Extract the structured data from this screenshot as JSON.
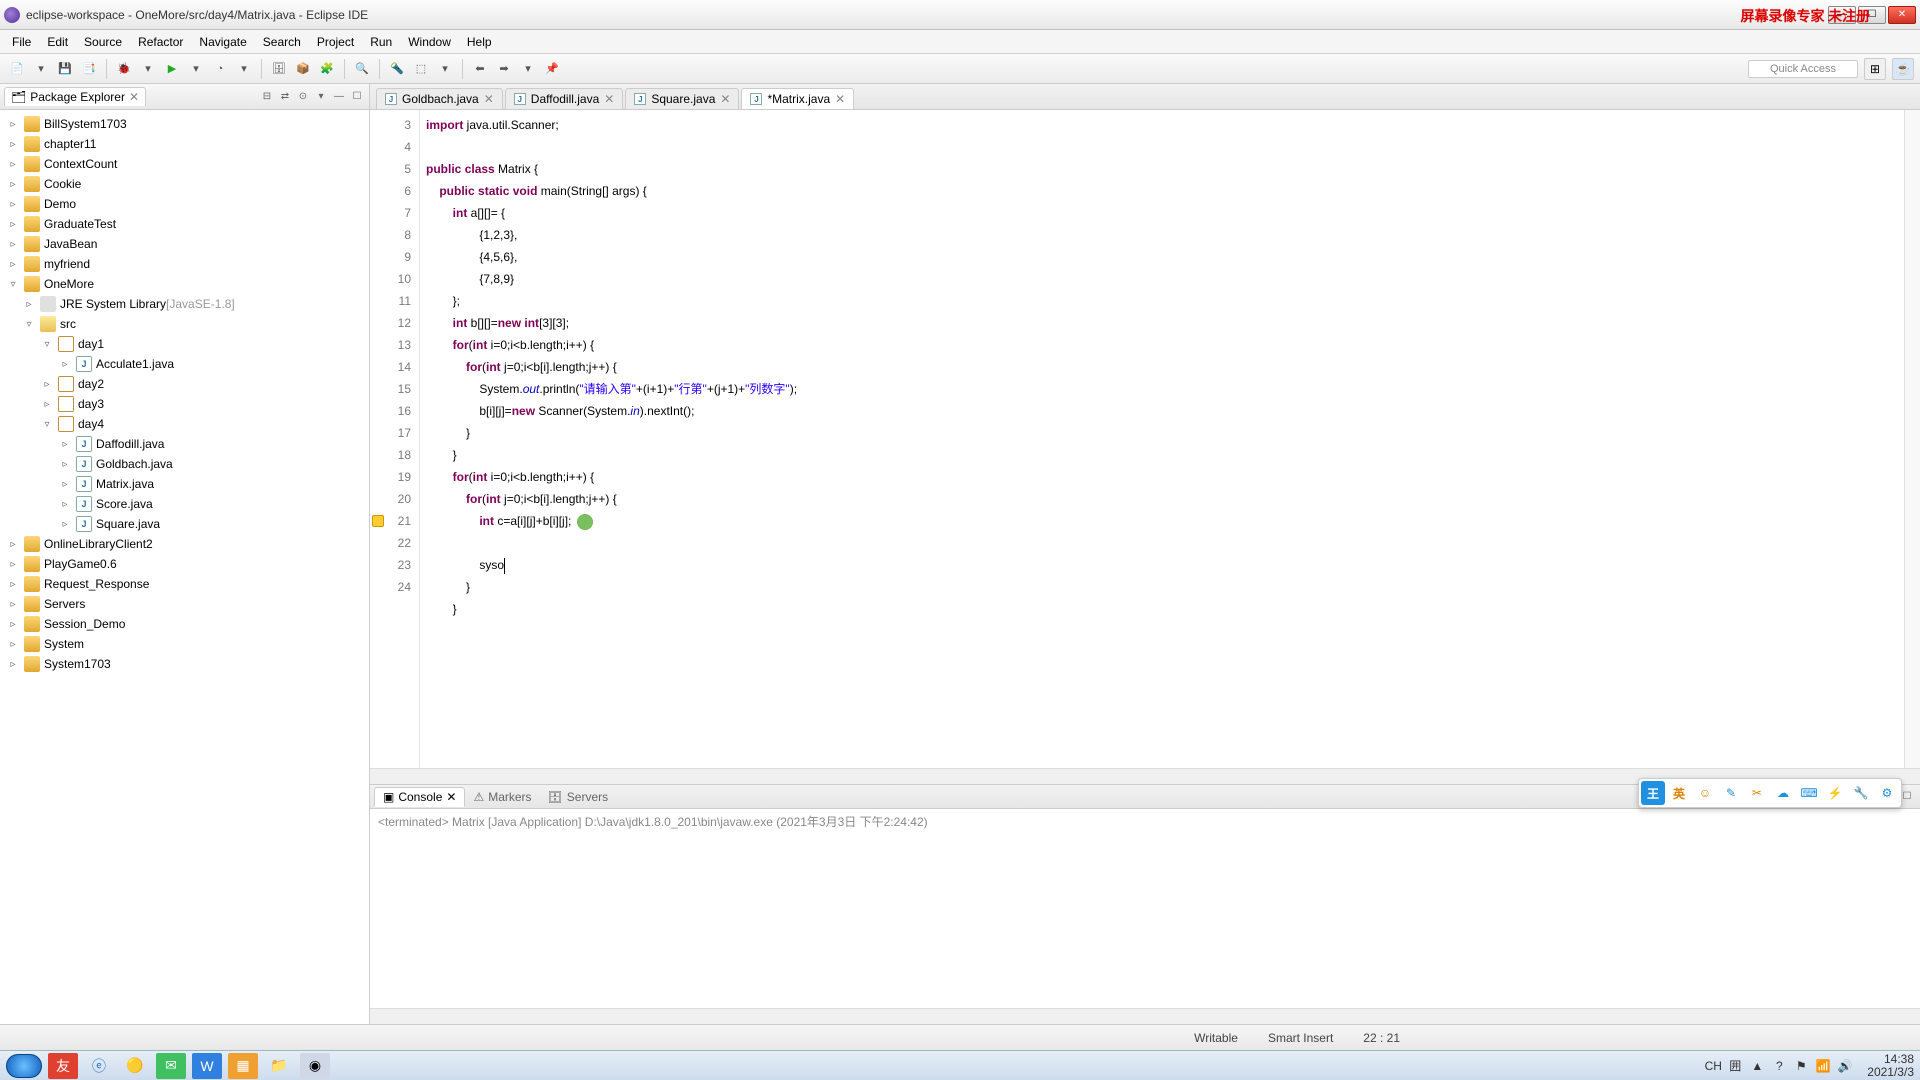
{
  "window": {
    "title": "eclipse-workspace - OneMore/src/day4/Matrix.java - Eclipse IDE",
    "overlay_text": "屏幕录像专家 未注册"
  },
  "menus": [
    "File",
    "Edit",
    "Source",
    "Refactor",
    "Navigate",
    "Search",
    "Project",
    "Run",
    "Window",
    "Help"
  ],
  "quick_access": "Quick Access",
  "package_explorer": {
    "title": "Package Explorer",
    "projects": [
      {
        "name": "BillSystem1703",
        "type": "prj",
        "exp": "▹"
      },
      {
        "name": "chapter11",
        "type": "prj",
        "exp": "▹"
      },
      {
        "name": "ContextCount",
        "type": "prj",
        "exp": "▹"
      },
      {
        "name": "Cookie",
        "type": "prj",
        "exp": "▹"
      },
      {
        "name": "Demo",
        "type": "prj",
        "exp": "▹"
      },
      {
        "name": "GraduateTest",
        "type": "prj",
        "exp": "▹"
      },
      {
        "name": "JavaBean",
        "type": "prj",
        "exp": "▹"
      },
      {
        "name": "myfriend",
        "type": "prj",
        "exp": "▹"
      },
      {
        "name": "OneMore",
        "type": "prj",
        "exp": "▿",
        "children": [
          {
            "name": "JRE System Library",
            "suffix": "[JavaSE-1.8]",
            "type": "lib",
            "exp": "▹",
            "pad": "pad1"
          },
          {
            "name": "src",
            "type": "fld",
            "exp": "▿",
            "pad": "pad1",
            "children": [
              {
                "name": "day1",
                "type": "pkg",
                "exp": "▿",
                "pad": "pad2",
                "children": [
                  {
                    "name": "Acculate1.java",
                    "type": "jfile",
                    "exp": "▹",
                    "pad": "pad3"
                  }
                ]
              },
              {
                "name": "day2",
                "type": "pkg",
                "exp": "▹",
                "pad": "pad2"
              },
              {
                "name": "day3",
                "type": "pkg",
                "exp": "▹",
                "pad": "pad2"
              },
              {
                "name": "day4",
                "type": "pkg",
                "exp": "▿",
                "pad": "pad2",
                "children": [
                  {
                    "name": "Daffodill.java",
                    "type": "jfile",
                    "exp": "▹",
                    "pad": "pad3"
                  },
                  {
                    "name": "Goldbach.java",
                    "type": "jfile",
                    "exp": "▹",
                    "pad": "pad3"
                  },
                  {
                    "name": "Matrix.java",
                    "type": "jfile",
                    "exp": "▹",
                    "pad": "pad3"
                  },
                  {
                    "name": "Score.java",
                    "type": "jfile",
                    "exp": "▹",
                    "pad": "pad3"
                  },
                  {
                    "name": "Square.java",
                    "type": "jfile",
                    "exp": "▹",
                    "pad": "pad3"
                  }
                ]
              }
            ]
          }
        ]
      },
      {
        "name": "OnlineLibraryClient2",
        "type": "prj",
        "exp": "▹"
      },
      {
        "name": "PlayGame0.6",
        "type": "prj",
        "exp": "▹"
      },
      {
        "name": "Request_Response",
        "type": "prj",
        "exp": "▹"
      },
      {
        "name": "Servers",
        "type": "prj",
        "exp": "▹"
      },
      {
        "name": "Session_Demo",
        "type": "prj",
        "exp": "▹"
      },
      {
        "name": "System",
        "type": "prj",
        "exp": "▹"
      },
      {
        "name": "System1703",
        "type": "prj",
        "exp": "▹"
      }
    ]
  },
  "editor_tabs": [
    {
      "label": "Goldbach.java",
      "active": false
    },
    {
      "label": "Daffodill.java",
      "active": false
    },
    {
      "label": "Square.java",
      "active": false
    },
    {
      "label": "*Matrix.java",
      "active": true
    }
  ],
  "code": {
    "first_line_no": 3,
    "lines": [
      {
        "no": 3,
        "html": "<span class='kw'>import</span> java.util.Scanner;"
      },
      {
        "no": 4,
        "html": ""
      },
      {
        "no": 5,
        "html": "<span class='kw'>public</span> <span class='kw'>class</span> Matrix {"
      },
      {
        "no": 6,
        "html": "    <span class='kw'>public</span> <span class='kw'>static</span> <span class='kw'>void</span> main(String[] args) {"
      },
      {
        "no": 7,
        "html": "        <span class='kw'>int</span> a[][]= {"
      },
      {
        "no": 8,
        "html": "                {1,2,3},"
      },
      {
        "no": 9,
        "html": "                {4,5,6},"
      },
      {
        "no": 10,
        "html": "                {7,8,9}"
      },
      {
        "no": 11,
        "html": "        };"
      },
      {
        "no": 12,
        "html": "        <span class='kw'>int</span> b[][]=<span class='kw'>new</span> <span class='kw'>int</span>[3][3];"
      },
      {
        "no": 13,
        "html": "        <span class='kw'>for</span>(<span class='kw'>int</span> i=0;i&lt;b.length;i++) {"
      },
      {
        "no": 14,
        "html": "            <span class='kw'>for</span>(<span class='kw'>int</span> j=0;i&lt;b[i].length;j++) {"
      },
      {
        "no": 15,
        "html": "                System.<span class='fld2'>out</span>.println(<span class='str'>\"请输入第\"</span>+(i+1)+<span class='str'>\"行第\"</span>+(j+1)+<span class='str'>\"列数字\"</span>);"
      },
      {
        "no": 16,
        "html": "                b[i][j]=<span class='kw'>new</span> Scanner(System.<span class='fld2'>in</span>).nextInt();"
      },
      {
        "no": 17,
        "html": "            }"
      },
      {
        "no": 18,
        "html": "        }"
      },
      {
        "no": 19,
        "html": "        <span class='kw'>for</span>(<span class='kw'>int</span> i=0;i&lt;b.length;i++) {"
      },
      {
        "no": 20,
        "html": "            <span class='kw'>for</span>(<span class='kw'>int</span> j=0;i&lt;b[i].length;j++) {"
      },
      {
        "no": 21,
        "html": "                <span class='kw'>int</span> c=a[i][j]+b[i][j]; <span class='cursor-dot'></span>",
        "warn": true
      },
      {
        "no": 22,
        "html": "                syso<span class='caret'></span>",
        "current": true
      },
      {
        "no": 23,
        "html": "            }"
      },
      {
        "no": 24,
        "html": "        }"
      }
    ]
  },
  "console": {
    "tabs": [
      "Console",
      "Markers",
      "Servers"
    ],
    "active": 0,
    "status": "<terminated> Matrix [Java Application] D:\\Java\\jdk1.8.0_201\\bin\\javaw.exe (2021年3月3日 下午2:24:42)"
  },
  "statusbar": {
    "writable": "Writable",
    "insert": "Smart Insert",
    "pos": "22 : 21"
  },
  "ime_label": "王",
  "ime_lang": "英",
  "tray": {
    "ch": "CH",
    "items": [
      "▲",
      "?",
      "⚑",
      "📶",
      "🔊"
    ],
    "time": "14:38",
    "date": "2021/3/3"
  }
}
